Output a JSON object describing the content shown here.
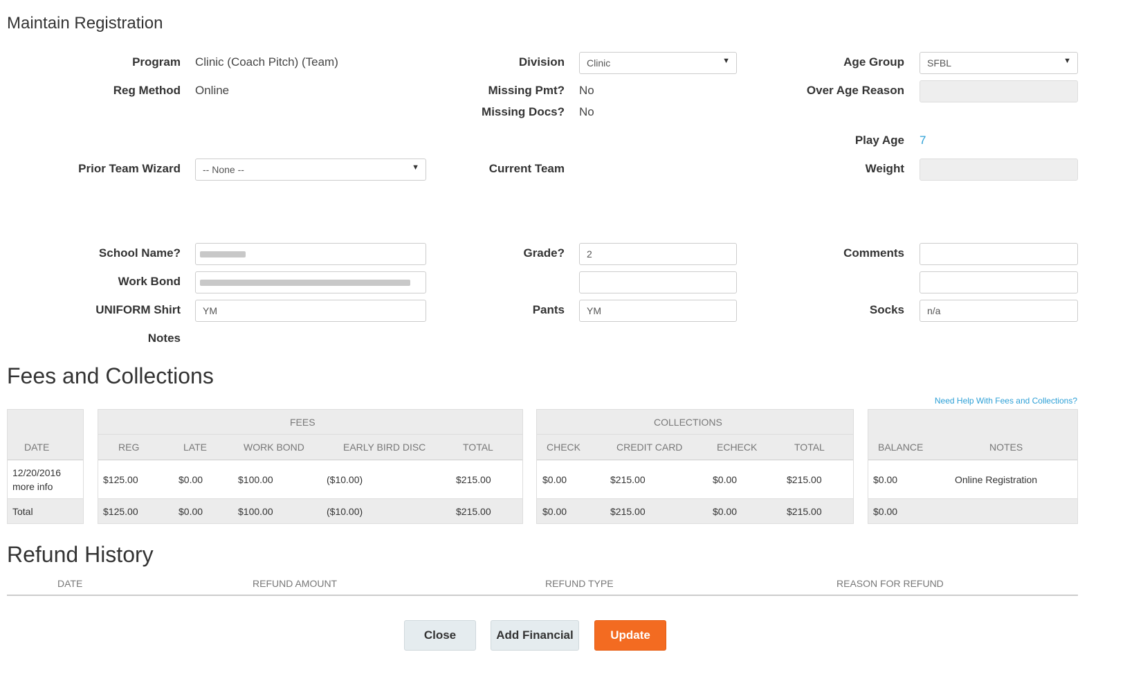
{
  "page_title": "Maintain Registration",
  "form": {
    "program_label": "Program",
    "program_value": "Clinic (Coach Pitch) (Team)",
    "reg_method_label": "Reg Method",
    "reg_method_value": "Online",
    "division_label": "Division",
    "division_value": "Clinic",
    "missing_pmt_label": "Missing Pmt?",
    "missing_pmt_value": "No",
    "missing_docs_label": "Missing Docs?",
    "missing_docs_value": "No",
    "age_group_label": "Age Group",
    "age_group_value": "SFBL",
    "over_age_reason_label": "Over Age Reason",
    "play_age_label": "Play Age",
    "play_age_value": "7",
    "prior_team_wizard_label": "Prior Team Wizard",
    "prior_team_wizard_value": "-- None --",
    "current_team_label": "Current Team",
    "weight_label": "Weight",
    "school_name_label": "School Name?",
    "work_bond_label": "Work Bond",
    "grade_label": "Grade?",
    "grade_value": "2",
    "comments_label": "Comments",
    "uniform_shirt_label": "UNIFORM Shirt",
    "uniform_shirt_value": "YM",
    "pants_label": "Pants",
    "pants_value": "YM",
    "socks_label": "Socks",
    "socks_value": "n/a",
    "notes_label": "Notes"
  },
  "fees_section": {
    "title": "Fees and Collections",
    "help_link": "Need Help With Fees and Collections?",
    "date_header": "DATE",
    "fees_group": "FEES",
    "fees_columns": [
      "REG",
      "LATE",
      "WORK BOND",
      "EARLY BIRD DISC",
      "TOTAL"
    ],
    "collections_group": "COLLECTIONS",
    "collections_columns": [
      "CHECK",
      "CREDIT CARD",
      "ECHECK",
      "TOTAL"
    ],
    "balance_columns": [
      "BALANCE",
      "NOTES"
    ],
    "row": {
      "date": "12/20/2016",
      "more_info": "more info",
      "fees": [
        "$125.00",
        "$0.00",
        "$100.00",
        "($10.00)",
        "$215.00"
      ],
      "collections": [
        "$0.00",
        "$215.00",
        "$0.00",
        "$215.00"
      ],
      "balance": "$0.00",
      "notes": "Online Registration"
    },
    "total": {
      "label": "Total",
      "fees": [
        "$125.00",
        "$0.00",
        "$100.00",
        "($10.00)",
        "$215.00"
      ],
      "collections": [
        "$0.00",
        "$215.00",
        "$0.00",
        "$215.00"
      ],
      "balance": "$0.00"
    }
  },
  "refund_section": {
    "title": "Refund History",
    "columns": [
      "DATE",
      "REFUND AMOUNT",
      "REFUND TYPE",
      "REASON FOR REFUND"
    ]
  },
  "buttons": {
    "close": "Close",
    "add_financial": "Add Financial",
    "update": "Update"
  },
  "colors": {
    "accent_orange": "#f36b21",
    "link_blue": "#2b9fd6",
    "table_grey": "#ececec"
  }
}
